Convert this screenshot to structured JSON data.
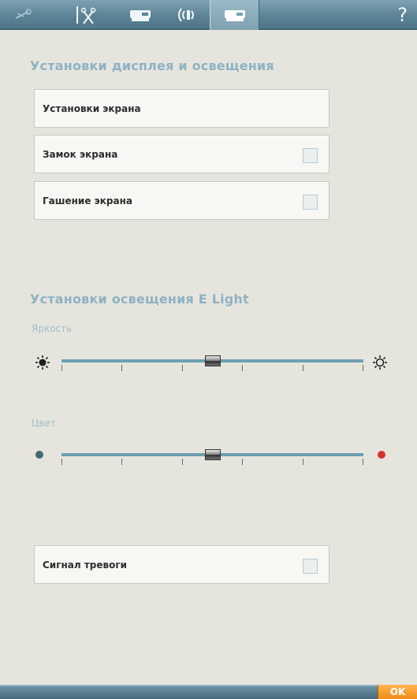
{
  "toolbar": {
    "tabs": [
      {
        "icon": "thread-icon"
      },
      {
        "icon": "needle-scissors-icon"
      },
      {
        "icon": "sewing-machine-icon"
      },
      {
        "icon": "sound-icon"
      },
      {
        "icon": "machine-settings-icon",
        "active": true
      }
    ],
    "help_label": "?"
  },
  "display_section": {
    "title": "Установки дисплея и освещения",
    "items": [
      {
        "label": "Установки экрана"
      },
      {
        "label": "Замок экрана",
        "checked": false
      },
      {
        "label": "Гашение экрана",
        "checked": false
      }
    ]
  },
  "light_section": {
    "title": "Установки освещения E Light",
    "brightness": {
      "label": "Яркость",
      "value": 0.5
    },
    "color": {
      "label": "Цвет",
      "value": 0.5
    }
  },
  "alarm": {
    "label": "Сигнал тревоги",
    "checked": false
  },
  "footer": {
    "ok_label": "OK"
  },
  "colors": {
    "accent": "#6f9fb1",
    "ok_button": "#f5a030",
    "cool_dot": "#3f6b75",
    "warm_dot": "#d8302b"
  }
}
